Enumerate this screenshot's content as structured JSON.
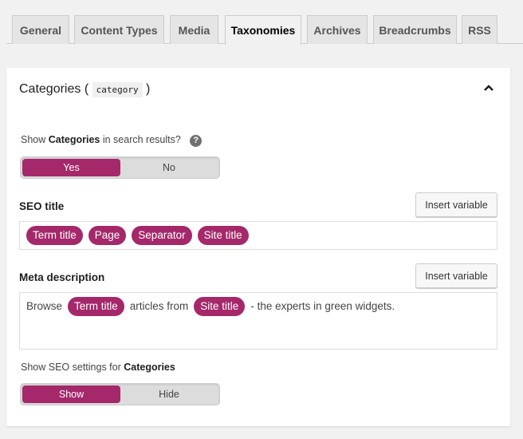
{
  "tabs": [
    "General",
    "Content Types",
    "Media",
    "Taxonomies",
    "Archives",
    "Breadcrumbs",
    "RSS"
  ],
  "active_tab": "Taxonomies",
  "panel": {
    "title": "Categories (",
    "code": "category",
    "title_end": ")",
    "collapse_icon": "chevron-up-icon",
    "search_question": {
      "pre": "Show ",
      "bold": "Categories",
      "post": " in search results?",
      "help_icon": "question-circle-icon"
    },
    "search_toggle": {
      "options": [
        "Yes",
        "No"
      ],
      "selected": "Yes"
    },
    "seo_title": {
      "label": "SEO title",
      "insert": "Insert variable",
      "pills": [
        "Term title",
        "Page",
        "Separator",
        "Site title"
      ]
    },
    "meta": {
      "label": "Meta description",
      "insert": "Insert variable",
      "parts": [
        "Browse",
        "Term title",
        "articles from",
        "Site title",
        "- the experts in green widgets."
      ]
    },
    "show_settings": {
      "pre": "Show SEO settings for ",
      "bold": "Categories"
    },
    "settings_toggle": {
      "options": [
        "Show",
        "Hide"
      ],
      "selected": "Show"
    },
    "accent": "#a4286a"
  }
}
